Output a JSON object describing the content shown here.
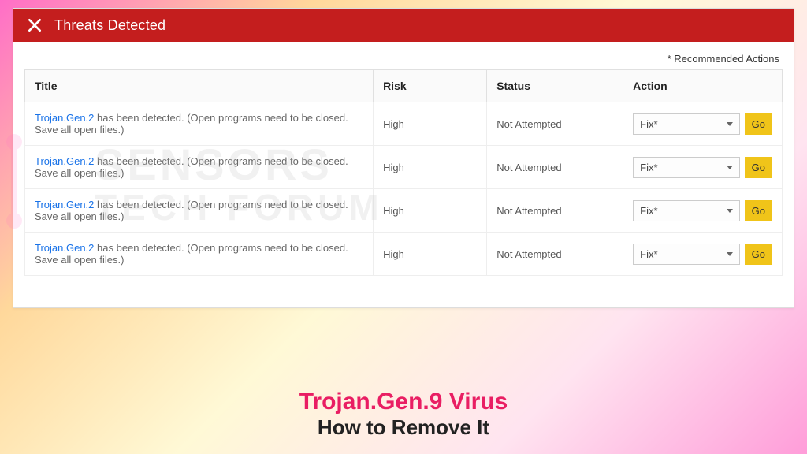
{
  "header": {
    "title": "Threats Detected"
  },
  "recommended_label": "* Recommended Actions",
  "table": {
    "columns": {
      "title": "Title",
      "risk": "Risk",
      "status": "Status",
      "action": "Action"
    },
    "rows": [
      {
        "threat_name": "Trojan.Gen.2",
        "description": " has been detected. (Open programs need to be closed. Save all open files.)",
        "risk": "High",
        "status": "Not Attempted",
        "action_selected": "Fix*",
        "go_label": "Go"
      },
      {
        "threat_name": "Trojan.Gen.2",
        "description": " has been detected. (Open programs need to be closed. Save all open files.)",
        "risk": "High",
        "status": "Not Attempted",
        "action_selected": "Fix*",
        "go_label": "Go"
      },
      {
        "threat_name": "Trojan.Gen.2",
        "description": " has been detected. (Open programs need to be closed. Save all open files.)",
        "risk": "High",
        "status": "Not Attempted",
        "action_selected": "Fix*",
        "go_label": "Go"
      },
      {
        "threat_name": "Trojan.Gen.2",
        "description": " has been detected. (Open programs need to be closed. Save all open files.)",
        "risk": "High",
        "status": "Not Attempted",
        "action_selected": "Fix*",
        "go_label": "Go"
      }
    ]
  },
  "watermark": {
    "line1": "SENSORS",
    "line2": "TECH FORUM"
  },
  "headline": {
    "title": "Trojan.Gen.9 Virus",
    "subtitle": "How to Remove It"
  }
}
